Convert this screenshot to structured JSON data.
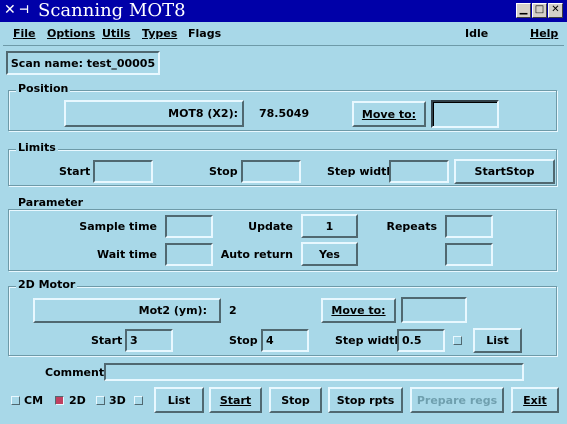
{
  "window": {
    "title": "Scanning MOT8",
    "min_icon": "minimize-icon",
    "max_icon": "maximize-icon",
    "close_icon": "close-icon"
  },
  "menubar": {
    "file": "File",
    "options": "Options",
    "utils": "Utils",
    "types": "Types",
    "flags": "Flags",
    "status": "Idle",
    "help": "Help"
  },
  "scan_name": "Scan name: test_00005",
  "position": {
    "title": "Position",
    "motor_label": "MOT8 (X2):",
    "motor_value": "78.5049",
    "move_to": "Move to:",
    "move_to_value": ""
  },
  "limits": {
    "title": "Limits",
    "start": "Start",
    "stop": "Stop",
    "step_width": "Step width",
    "start_value": "",
    "stop_value": "",
    "step_value": "",
    "startstop_btn": "StartStop"
  },
  "parameter": {
    "title": "Parameter",
    "sample_time": "Sample time",
    "wait_time": "Wait time",
    "update": "Update",
    "update_value": "1",
    "auto_return": "Auto return",
    "auto_return_value": "Yes",
    "repeats": "Repeats"
  },
  "motor2d": {
    "title": "2D Motor",
    "motor_label": "Mot2 (ym):",
    "motor_value": "2",
    "move_to": "Move to:",
    "start": "Start",
    "start_value": "3",
    "stop": "Stop",
    "stop_value": "4",
    "step_width": "Step width",
    "step_value": "0.5",
    "list_btn": "List"
  },
  "comment": {
    "label": "Comment:",
    "value": ""
  },
  "bottom": {
    "cm": "CM",
    "cm_checked": false,
    "d2": "2D",
    "d2_checked": true,
    "d3": "3D",
    "d3_checked": false,
    "list": "List",
    "start": "Start",
    "stop": "Stop",
    "stop_rpts": "Stop rpts",
    "prepare_regs": "Prepare regs",
    "exit": "Exit"
  }
}
